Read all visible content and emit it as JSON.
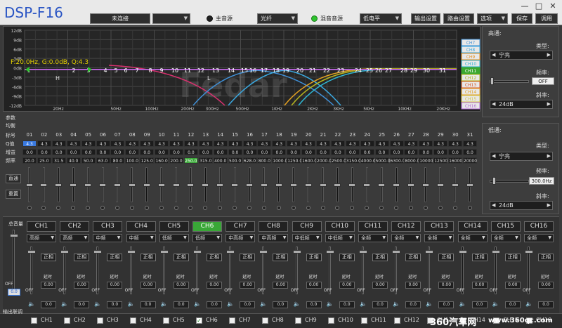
{
  "app": {
    "title": "DSP-F16"
  },
  "toolbar": {
    "connect_label": "未连接",
    "preset_value": "",
    "main_source_label": "主音源",
    "main_source_value": "光纤",
    "mix_source_label": "混音音源",
    "mix_source_value": "低电平",
    "buttons": [
      "输出设置",
      "路由设置",
      "选项",
      "保存",
      "调用"
    ],
    "win_minimize": "—",
    "win_maximize": "□",
    "win_close": "✕"
  },
  "eq_graph": {
    "readout": "F:20.0Hz, G:0.0dB, Q:4.3",
    "y_labels": [
      "12dB",
      "9dB",
      "6dB",
      "3dB",
      "0dB",
      "-3dB",
      "-6dB",
      "-9dB",
      "-12dB"
    ],
    "x_labels": [
      "20Hz",
      "50Hz",
      "100Hz",
      "200Hz",
      "300Hz",
      "500Hz",
      "1KHz",
      "2KHz",
      "3KHz",
      "5KHz",
      "10KHz",
      "20KHz"
    ],
    "band_markers": [
      "1",
      "2",
      "3",
      "4",
      "5",
      "6",
      "7",
      "8",
      "9",
      "10",
      "11",
      "12",
      "13",
      "14",
      "15",
      "16",
      "17",
      "18",
      "19",
      "20",
      "21",
      "22",
      "23",
      "24",
      "25",
      "26",
      "27",
      "28",
      "29",
      "30",
      "31"
    ],
    "marker_h": "H",
    "marker_l": "L",
    "watermark": "Fedar",
    "legend": [
      {
        "label": "CH7",
        "color": "#3f8fd6"
      },
      {
        "label": "CH8",
        "color": "#3aa8e0"
      },
      {
        "label": "CH9",
        "color": "#e8901e"
      },
      {
        "label": "CH10",
        "color": "#2fb6d2"
      },
      {
        "label": "CH11",
        "color": "#3aa72e"
      },
      {
        "label": "CH12",
        "color": "#b4b41e"
      },
      {
        "label": "CH13",
        "color": "#d85a2a"
      },
      {
        "label": "CH14",
        "color": "#e2a022"
      },
      {
        "label": "CH15",
        "color": "#d4c64a"
      },
      {
        "label": "CH16",
        "color": "#b56ad8"
      }
    ]
  },
  "high_pass": {
    "title": "高通:",
    "type_label": "类型:",
    "type_value": "宁亮",
    "freq_label": "频率:",
    "freq_value": "OFF",
    "slope_label": "斜率:",
    "slope_value": "24dB"
  },
  "low_pass": {
    "title": "低通:",
    "type_label": "类型:",
    "type_value": "宁亮",
    "freq_label": "频率:",
    "freq_value": "300.0Hz",
    "slope_label": "斜率:",
    "slope_value": "24dB"
  },
  "band_table": {
    "params_label": "参数",
    "eq_label": "均衡",
    "row_labels": [
      "标号",
      "Q值",
      "增益",
      "频率"
    ],
    "straight_label": "直通",
    "reset_label": "重置",
    "band_numbers": [
      "01",
      "02",
      "03",
      "04",
      "05",
      "06",
      "07",
      "08",
      "09",
      "10",
      "11",
      "12",
      "13",
      "14",
      "15",
      "16",
      "17",
      "18",
      "19",
      "20",
      "21",
      "22",
      "23",
      "24",
      "25",
      "26",
      "27",
      "28",
      "29",
      "30",
      "31"
    ],
    "q_values": [
      "4.3",
      "4.3",
      "4.3",
      "4.3",
      "4.3",
      "4.3",
      "4.3",
      "4.3",
      "4.3",
      "4.3",
      "4.3",
      "4.3",
      "4.3",
      "4.3",
      "4.3",
      "4.3",
      "4.3",
      "4.3",
      "4.3",
      "4.3",
      "4.3",
      "4.3",
      "4.3",
      "4.3",
      "4.3",
      "4.3",
      "4.3",
      "4.3",
      "4.3",
      "4.3",
      "4.3"
    ],
    "gain_values": [
      "0.0",
      "0.0",
      "0.0",
      "0.0",
      "0.0",
      "0.0",
      "0.0",
      "0.0",
      "0.0",
      "0.0",
      "0.0",
      "0.0",
      "0.0",
      "0.0",
      "0.0",
      "0.0",
      "0.0",
      "0.0",
      "0.0",
      "0.0",
      "0.0",
      "0.0",
      "0.0",
      "0.0",
      "0.0",
      "0.0",
      "0.0",
      "0.0",
      "0.0",
      "0.0",
      "0.0"
    ],
    "freq_values": [
      "20.0",
      "25.0",
      "31.5",
      "40.0",
      "50.0",
      "63.0",
      "80.0",
      "100.0",
      "125.0",
      "160.0",
      "200.0",
      "250.0",
      "315.0",
      "400.0",
      "500.0",
      "628.0",
      "800.0",
      "1000.0",
      "1250.0",
      "1600.0",
      "2000.0",
      "2500.0",
      "3150.0",
      "4000.0",
      "5000.0",
      "6300.0",
      "8000.0",
      "10000",
      "12500",
      "16000",
      "20000"
    ],
    "selected_index": 11
  },
  "master": {
    "label": "总音量",
    "value": "0.0",
    "off": "OFF"
  },
  "channels": [
    {
      "name": "CH1",
      "type": "高频",
      "delay": "0.00",
      "vol": "0.0"
    },
    {
      "name": "CH2",
      "type": "高频",
      "delay": "0.00",
      "vol": "0.0"
    },
    {
      "name": "CH3",
      "type": "中频",
      "delay": "0.00",
      "vol": "0.0"
    },
    {
      "name": "CH4",
      "type": "中频",
      "delay": "0.00",
      "vol": "0.0"
    },
    {
      "name": "CH5",
      "type": "低频",
      "delay": "0.00",
      "vol": "0.0"
    },
    {
      "name": "CH6",
      "type": "低频",
      "delay": "0.00",
      "vol": "0.0"
    },
    {
      "name": "CH7",
      "type": "中高频",
      "delay": "0.00",
      "vol": "0.0"
    },
    {
      "name": "CH8",
      "type": "中高频",
      "delay": "0.00",
      "vol": "0.0"
    },
    {
      "name": "CH9",
      "type": "中低频",
      "delay": "0.00",
      "vol": "0.0"
    },
    {
      "name": "CH10",
      "type": "中低频",
      "delay": "0.00",
      "vol": "0.0"
    },
    {
      "name": "CH11",
      "type": "全频",
      "delay": "0.00",
      "vol": "0.0"
    },
    {
      "name": "CH12",
      "type": "全频",
      "delay": "0.00",
      "vol": "0.0"
    },
    {
      "name": "CH13",
      "type": "全频",
      "delay": "0.00",
      "vol": "0.0"
    },
    {
      "name": "CH14",
      "type": "全频",
      "delay": "0.00",
      "vol": "0.0"
    },
    {
      "name": "CH15",
      "type": "全频",
      "delay": "0.00",
      "vol": "0.0"
    },
    {
      "name": "CH16",
      "type": "全频",
      "delay": "0.00",
      "vol": "0.0"
    }
  ],
  "channel_labels": {
    "phase": "正相",
    "delay": "延时",
    "off": "OFF"
  },
  "active_channel": 5,
  "output_link": {
    "label": "输出联调",
    "items": [
      "CH1",
      "CH2",
      "CH3",
      "CH4",
      "CH5",
      "CH6",
      "CH7",
      "CH8",
      "CH9",
      "CH10",
      "CH11",
      "CH12",
      "CH13",
      "CH14",
      "CH15",
      "CH16"
    ],
    "checked_index": 5
  },
  "watermark": {
    "brand": "360汽车网",
    "url": "www.360qc.com"
  }
}
